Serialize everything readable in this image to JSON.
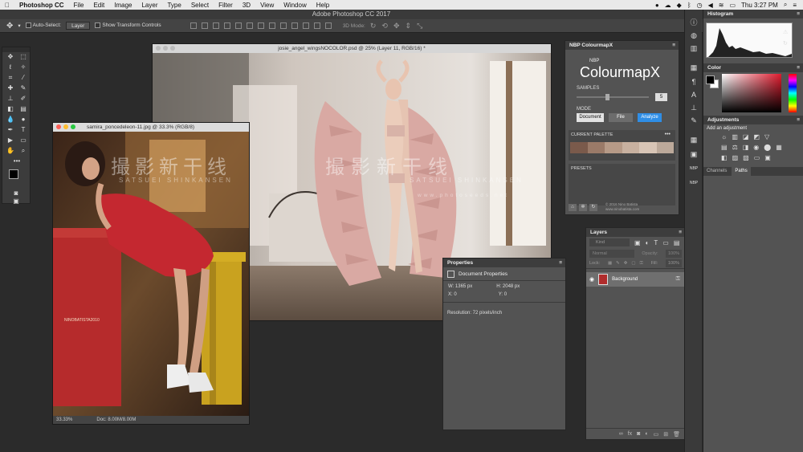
{
  "menubar": {
    "app": "Photoshop CC",
    "items": [
      "File",
      "Edit",
      "Image",
      "Layer",
      "Type",
      "Select",
      "Filter",
      "3D",
      "View",
      "Window",
      "Help"
    ],
    "clock": "Thu 3:27 PM"
  },
  "titlebar": {
    "title": "Adobe Photoshop CC 2017"
  },
  "options": {
    "auto_select": "Auto-Select:",
    "layer": "Layer",
    "transform": "Show Transform Controls",
    "mode3d": "3D Mode:"
  },
  "doc1": {
    "title": "samira_poncedeleon-11.jpg @ 33.3% (RGB/8)",
    "zoom": "33.33%",
    "docsize": "Doc: 8.00M/8.00M",
    "signature": "NINOBATISTA2010"
  },
  "doc2": {
    "title": "josie_angel_wingsNOCOLOR.psd @ 25% (Layer 11, RGB/16) *"
  },
  "colourmap": {
    "panel_title": "NBP ColourmapX",
    "logo_small": "NBP",
    "logo": "ColourmapX",
    "samples_label": "SAMPLES",
    "samples_value": "5",
    "mode_label": "MODE",
    "mode_buttons": [
      "Document",
      "File",
      "Analyze"
    ],
    "palette_label": "CURRENT PALETTE",
    "presets_label": "PRESETS",
    "copyright": "© 2016 Nino Batista",
    "url": "www.ninobatista.com"
  },
  "palette_colors": [
    "#7a5a4b",
    "#9a7a68",
    "#b69a87",
    "#c8b1a0",
    "#d8c5b6",
    "#bca99a"
  ],
  "properties": {
    "title": "Properties",
    "header": "Document Properties",
    "w": "W:  1365 px",
    "h": "H:  2048 px",
    "x": "X:  0",
    "y": "Y:  0",
    "resolution": "Resolution: 72 pixels/inch"
  },
  "layers": {
    "title": "Layers",
    "kind": "Kind",
    "mode": "Normal",
    "opacity": "Opacity:",
    "opacity_val": "100%",
    "lock": "Lock:",
    "fill": "Fill:",
    "fill_val": "100%",
    "layer_name": "Background"
  },
  "histogram": {
    "title": "Histogram"
  },
  "color": {
    "title": "Color"
  },
  "adjustments": {
    "title": "Adjustments",
    "subtitle": "Add an adjustment"
  },
  "tabs": {
    "channels": "Channels",
    "paths": "Paths"
  },
  "watermark": {
    "cjk": "撮影新干线",
    "latin": "SATSUEI SHINKANSEN",
    "url": "www.photoseeds.net"
  }
}
